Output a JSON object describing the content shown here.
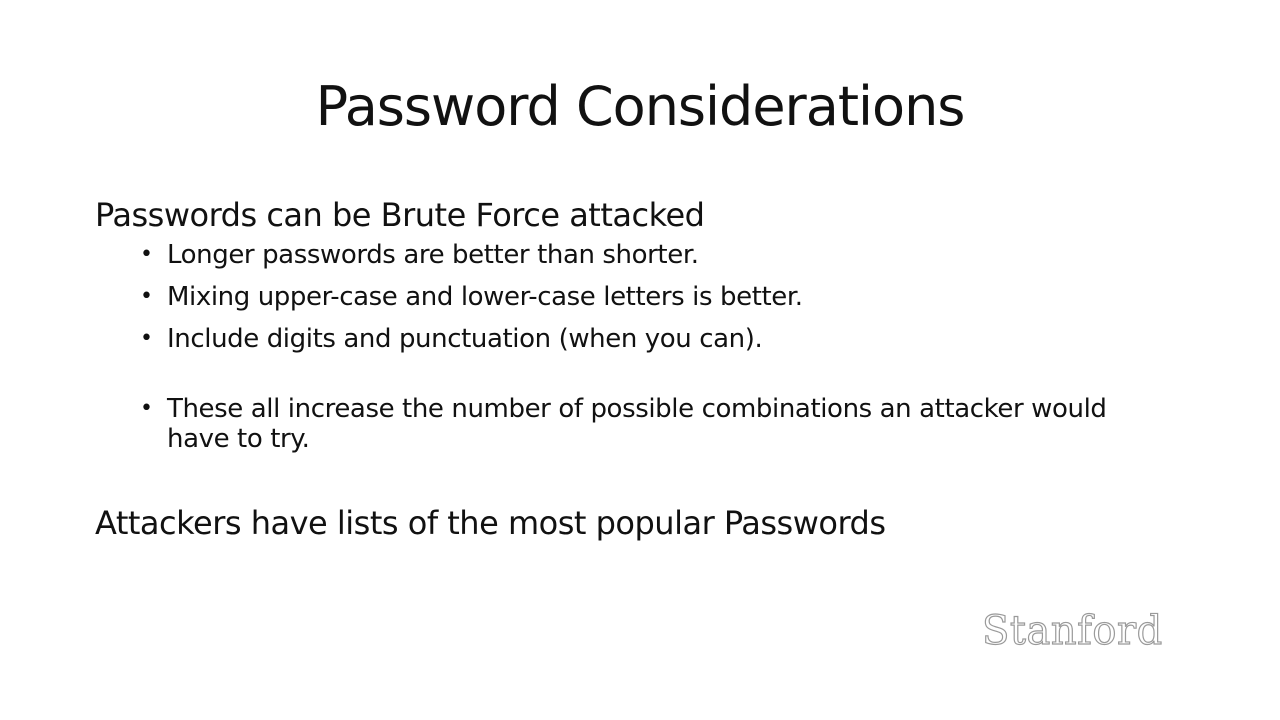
{
  "slide": {
    "title": "Password Considerations",
    "sections": [
      {
        "heading": "Passwords can be Brute Force attacked",
        "bullets": [
          "Longer passwords are better than shorter.",
          "Mixing upper-case and lower-case letters is better.",
          "Include digits and punctuation (when you can).",
          "These all increase the number of possible combinations an attacker would have to try."
        ]
      },
      {
        "heading": "Attackers have lists of the most popular Passwords"
      }
    ],
    "logo_text": "Stanford",
    "bullet_glyph": "•"
  },
  "colors": {
    "text": "#111111",
    "background": "#ffffff",
    "logo_outline": "#9a9a9a"
  }
}
